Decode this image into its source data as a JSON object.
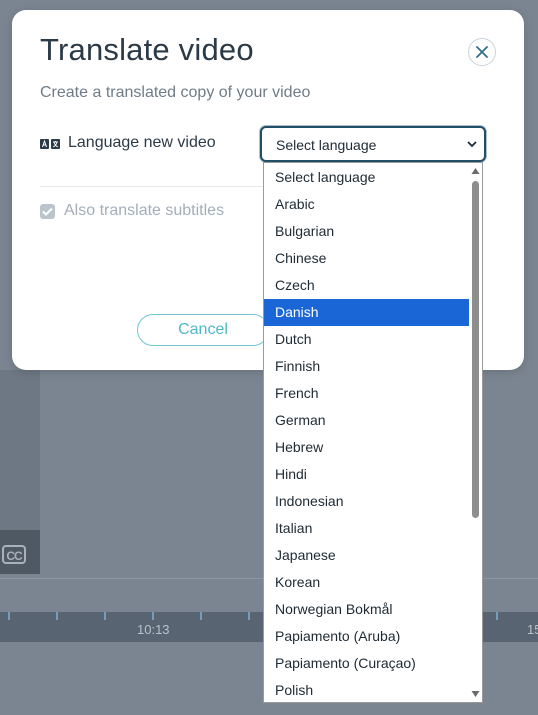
{
  "modal": {
    "title": "Translate video",
    "subtitle": "Create a translated copy of your video",
    "language_label": "Language new video",
    "select_value": "Select language",
    "subtitles_label": "Also translate subtitles",
    "subtitles_checked": true,
    "cancel_label": "Cancel"
  },
  "icons": {
    "close": "close-icon",
    "language": "translate-icon",
    "select_caret": "chevron-down-icon",
    "checkbox": "checkmark-icon"
  },
  "dropdown": {
    "options": [
      "Select language",
      "Arabic",
      "Bulgarian",
      "Chinese",
      "Czech",
      "Danish",
      "Dutch",
      "Finnish",
      "French",
      "German",
      "Hebrew",
      "Hindi",
      "Indonesian",
      "Italian",
      "Japanese",
      "Korean",
      "Norwegian Bokmål",
      "Papiamento (Aruba)",
      "Papiamento (Curaçao)",
      "Polish"
    ],
    "highlighted_index": 5
  },
  "background": {
    "cc_label": "CC",
    "timeline_labels": [
      "10:13",
      "15"
    ]
  },
  "colors": {
    "highlight": "#1a66d6",
    "accent": "#4fb8c6",
    "select_border": "#1f4f66"
  }
}
